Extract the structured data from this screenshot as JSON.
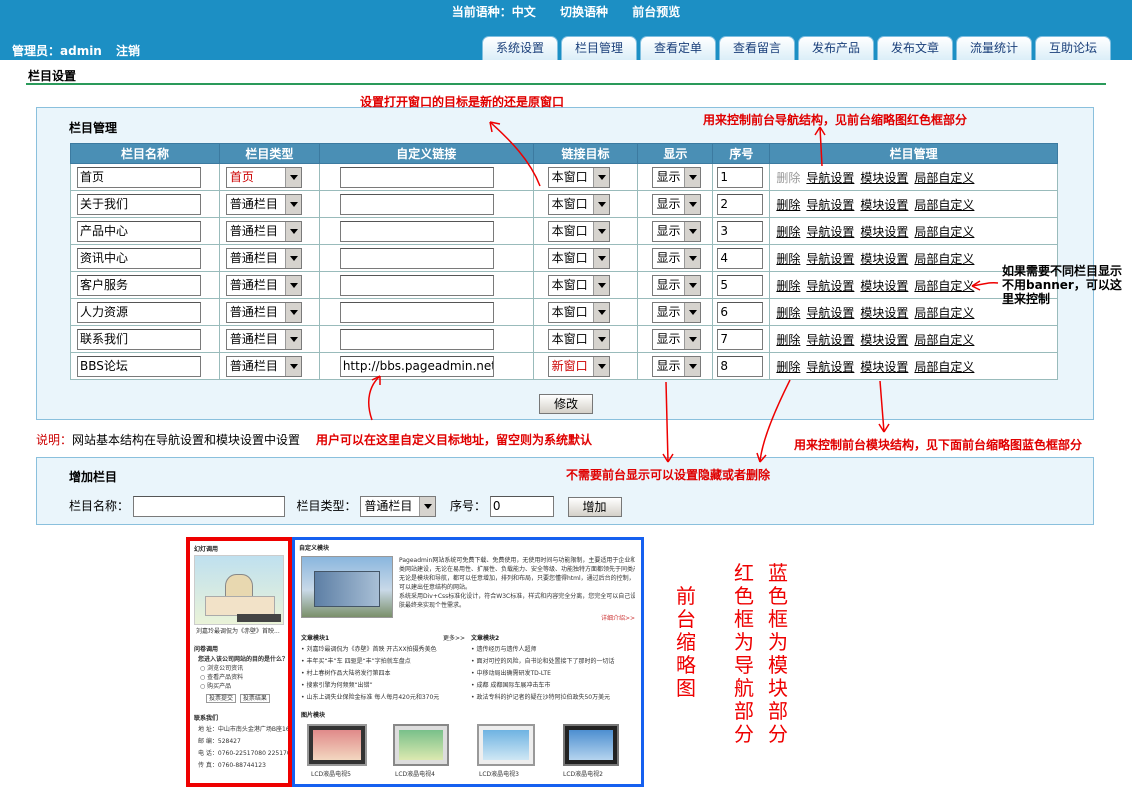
{
  "header": {
    "language_label": "当前语种：中文",
    "switch_language": "切换语种",
    "preview": "前台预览",
    "admin_label": "管理员：admin",
    "logout": "注销"
  },
  "tabs": [
    "系统设置",
    "栏目管理",
    "查看定单",
    "查看留言",
    "发布产品",
    "发布文章",
    "流量统计",
    "互助论坛"
  ],
  "page_title": "栏目设置",
  "section_manage": "栏目管理",
  "table": {
    "headers": [
      "栏目名称",
      "栏目类型",
      "自定义链接",
      "链接目标",
      "显示",
      "序号",
      "栏目管理"
    ],
    "rows": [
      {
        "name": "首页",
        "type": "首页",
        "link": "",
        "target": "本窗口",
        "show": "显示",
        "order": "1"
      },
      {
        "name": "关于我们",
        "type": "普通栏目",
        "link": "",
        "target": "本窗口",
        "show": "显示",
        "order": "2"
      },
      {
        "name": "产品中心",
        "type": "普通栏目",
        "link": "",
        "target": "本窗口",
        "show": "显示",
        "order": "3"
      },
      {
        "name": "资讯中心",
        "type": "普通栏目",
        "link": "",
        "target": "本窗口",
        "show": "显示",
        "order": "4"
      },
      {
        "name": "客户服务",
        "type": "普通栏目",
        "link": "",
        "target": "本窗口",
        "show": "显示",
        "order": "5"
      },
      {
        "name": "人力资源",
        "type": "普通栏目",
        "link": "",
        "target": "本窗口",
        "show": "显示",
        "order": "6"
      },
      {
        "name": "联系我们",
        "type": "普通栏目",
        "link": "",
        "target": "本窗口",
        "show": "显示",
        "order": "7"
      },
      {
        "name": "BBS论坛",
        "type": "普通栏目",
        "link": "http://bbs.pageadmin.net/",
        "target": "新窗口",
        "show": "显示",
        "order": "8"
      }
    ],
    "actions": {
      "delete": "删除",
      "nav": "导航设置",
      "module": "模块设置",
      "local": "局部自定义"
    }
  },
  "modify_button": "修改",
  "note_label": "说明：",
  "note_text": "网站基本结构在导航设置和模块设置中设置",
  "add": {
    "title": "增加栏目",
    "name_label": "栏目名称：",
    "type_label": "栏目类型：",
    "type_value": "普通栏目",
    "order_label": "序号：",
    "order_value": "0",
    "button": "增加"
  },
  "annotations": {
    "target": "设置打开窗口的目标是新的还是原窗口",
    "nav": "用来控制前台导航结构，见前台缩略图红色框部分",
    "banner": "如果需要不同栏目显示不用banner，可以这里来控制",
    "custom_link": "用户可以在这里自定义目标地址，留空则为系统默认",
    "module": "用来控制前台模块结构，见下面前台缩略图蓝色框部分",
    "hide": "不需要前台显示可以设置隐藏或者删除"
  },
  "legend": {
    "thumb": "前台缩略图",
    "red": "红色框为导航部分",
    "blue": "蓝色框为模块部分"
  },
  "thumb_red": {
    "h1": "幻灯调用",
    "caption": "刘嘉玲最调侃为《赤壁》首映...",
    "h2": "问卷调用",
    "question": "您进入该公司网站的目的是什么？",
    "opts": [
      "浏览公司资讯",
      "查看产品资料",
      "购买产品"
    ],
    "vote": "投票提交",
    "result": "投票结果",
    "h3": "联系我们",
    "contact": [
      "地 址：中山市南头金港广场B座16号",
      "邮 编：528427",
      "电 话：0760-22517080  22517082",
      "传 真：0760-88744123"
    ]
  },
  "thumb_blue": {
    "h1": "自定义模块",
    "text": [
      "Pageadmin网站系统可免费下载、免费使用，无使用时间与功能限制，主要适用于企业和学校",
      "类网站建设，无论在易用性、扩展性、负载能力、安全等级、功能独特方面都领先于同类产品。",
      "无论是模块和导航，都可以任意增加，排列和布局，只要您懂得html，通过后台的控制，能",
      "可以建出任意结构的网站。",
      "系统采用Div+Css标准化设计，符合W3C标准，样式和内容完全分离，您完全可以自己设计皮",
      "肤最终来实现个性需求。"
    ],
    "more": "详细介绍>>",
    "h2": "文章模块1",
    "h3": "文章模块2",
    "more2": "更多>>",
    "list1": [
      "刘嘉玲最调侃为《赤壁》首映 开古XX拍摄秀美色",
      "丰年买“丰”车 四驱是“丰”字拍就车盘点",
      "村上春树作品大陆将发行第四本",
      "搜索引擎为何频频“出错”",
      "山东上调失业保险金标准 每人每月420元和370元"
    ],
    "list2": [
      "遗传经历与遗传人超师",
      "面对可控的风险，自书论和处置接下了那时的一切话",
      "中移动局出确需研发TD-LTE",
      "成都 成都国际车展冲击车市",
      "政法专科的护记者的疑在沙特阿拉伯政失50万美元"
    ],
    "h4": "图片模块",
    "pics": [
      "LCD液晶电视5",
      "LCD液晶电视4",
      "LCD液晶电视3",
      "LCD液晶电视2"
    ]
  },
  "colors": {
    "header": "#1c8fc4",
    "red_annotation": "#e00000",
    "blue_frame": "#1560f0"
  }
}
